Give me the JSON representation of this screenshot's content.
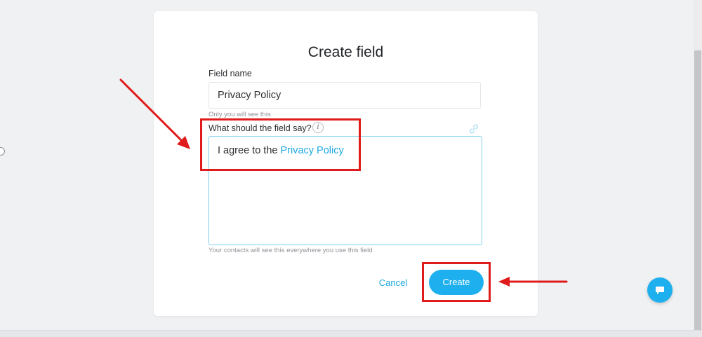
{
  "modal": {
    "title": "Create field",
    "field_name": {
      "label": "Field name",
      "value": "Privacy Policy",
      "hint": "Only you will see this"
    },
    "field_say": {
      "label": "What should the field say?",
      "text_prefix": "I agree to the ",
      "link_text": "Privacy Policy",
      "hint": "Your contacts will see this everywhere you use this field"
    },
    "actions": {
      "cancel_label": "Cancel",
      "create_label": "Create"
    }
  },
  "icons": {
    "info": "info-icon",
    "link": "link-icon",
    "chat": "chat-icon"
  },
  "colors": {
    "accent": "#1eb0ee",
    "link": "#1ca9e0",
    "annotation": "#e01b1b",
    "textarea_border": "#7fd0ee"
  }
}
